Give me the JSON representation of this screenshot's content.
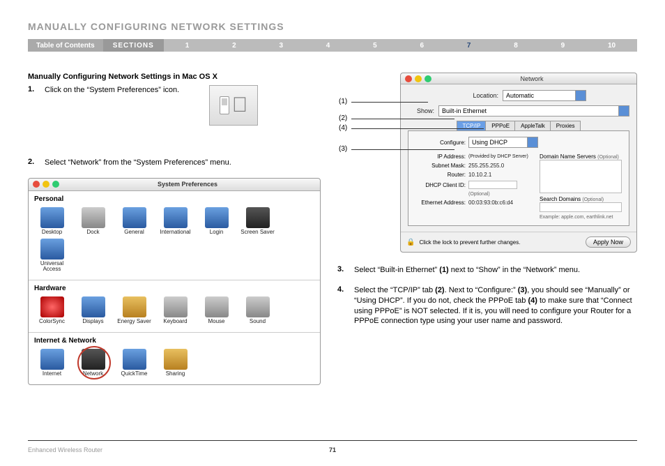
{
  "header": {
    "title": "MANUALLY CONFIGURING NETWORK SETTINGS",
    "toc_label": "Table of Contents",
    "sections_label": "SECTIONS",
    "section_numbers": [
      "1",
      "2",
      "3",
      "4",
      "5",
      "6",
      "7",
      "8",
      "9",
      "10"
    ],
    "active_section": "7"
  },
  "left": {
    "subheading": "Manually Configuring Network Settings in Mac OS X",
    "step1_num": "1.",
    "step1_text": "Click on the “System Preferences” icon.",
    "step2_num": "2.",
    "step2_text": "Select “Network” from the “System Preferences” menu."
  },
  "syspref": {
    "window_title": "System Preferences",
    "sections": [
      {
        "label": "Personal",
        "items": [
          "Desktop",
          "Dock",
          "General",
          "International",
          "Login",
          "Screen Saver",
          "Universal Access"
        ]
      },
      {
        "label": "Hardware",
        "items": [
          "ColorSync",
          "Displays",
          "Energy Saver",
          "Keyboard",
          "Mouse",
          "Sound"
        ]
      },
      {
        "label": "Internet & Network",
        "items": [
          "Internet",
          "Network",
          "QuickTime",
          "Sharing"
        ]
      }
    ],
    "circled_item": "Network"
  },
  "callouts": {
    "c1": "(1)",
    "c2": "(2)",
    "c4": "(4)",
    "c3": "(3)"
  },
  "network": {
    "window_title": "Network",
    "location_label": "Location:",
    "location_value": "Automatic",
    "show_label": "Show:",
    "show_value": "Built-in Ethernet",
    "tabs": [
      "TCP/IP",
      "PPPoE",
      "AppleTalk",
      "Proxies"
    ],
    "active_tab": "TCP/IP",
    "configure_label": "Configure:",
    "configure_value": "Using DHCP",
    "ip_label": "IP Address:",
    "ip_value": "(Provided by DHCP Server)",
    "subnet_label": "Subnet Mask:",
    "subnet_value": "255.255.255.0",
    "router_label": "Router:",
    "router_value": "10.10.2.1",
    "dhcp_label": "DHCP Client ID:",
    "dhcp_note": "(Optional)",
    "eth_label": "Ethernet Address:",
    "eth_value": "00:03:93:0b:c6:d4",
    "dns_label": "Domain Name Servers",
    "dns_opt": "(Optional)",
    "search_label": "Search Domains",
    "search_opt": "(Optional)",
    "example": "Example: apple.com, earthlink.net",
    "lock_text": "Click the lock to prevent further changes.",
    "apply_label": "Apply Now"
  },
  "right_steps": {
    "step3_num": "3.",
    "step3_text_a": "Select “Built-in Ethernet” ",
    "step3_bold": "(1)",
    "step3_text_b": " next to “Show” in the “Network” menu.",
    "step4_num": "4.",
    "step4_text_a": "Select the “TCP/IP” tab ",
    "step4_b2": "(2)",
    "step4_text_b": ". Next to “Configure:” ",
    "step4_b3": "(3)",
    "step4_text_c": ", you should see “Manually” or “Using DHCP”. If you do not, check the PPPoE tab ",
    "step4_b4": "(4)",
    "step4_text_d": " to make sure that “Connect using PPPoE” is NOT selected. If it is, you will need to configure your Router for a PPPoE connection type using your user name and password."
  },
  "footer": {
    "product": "Enhanced Wireless Router",
    "page": "71"
  }
}
